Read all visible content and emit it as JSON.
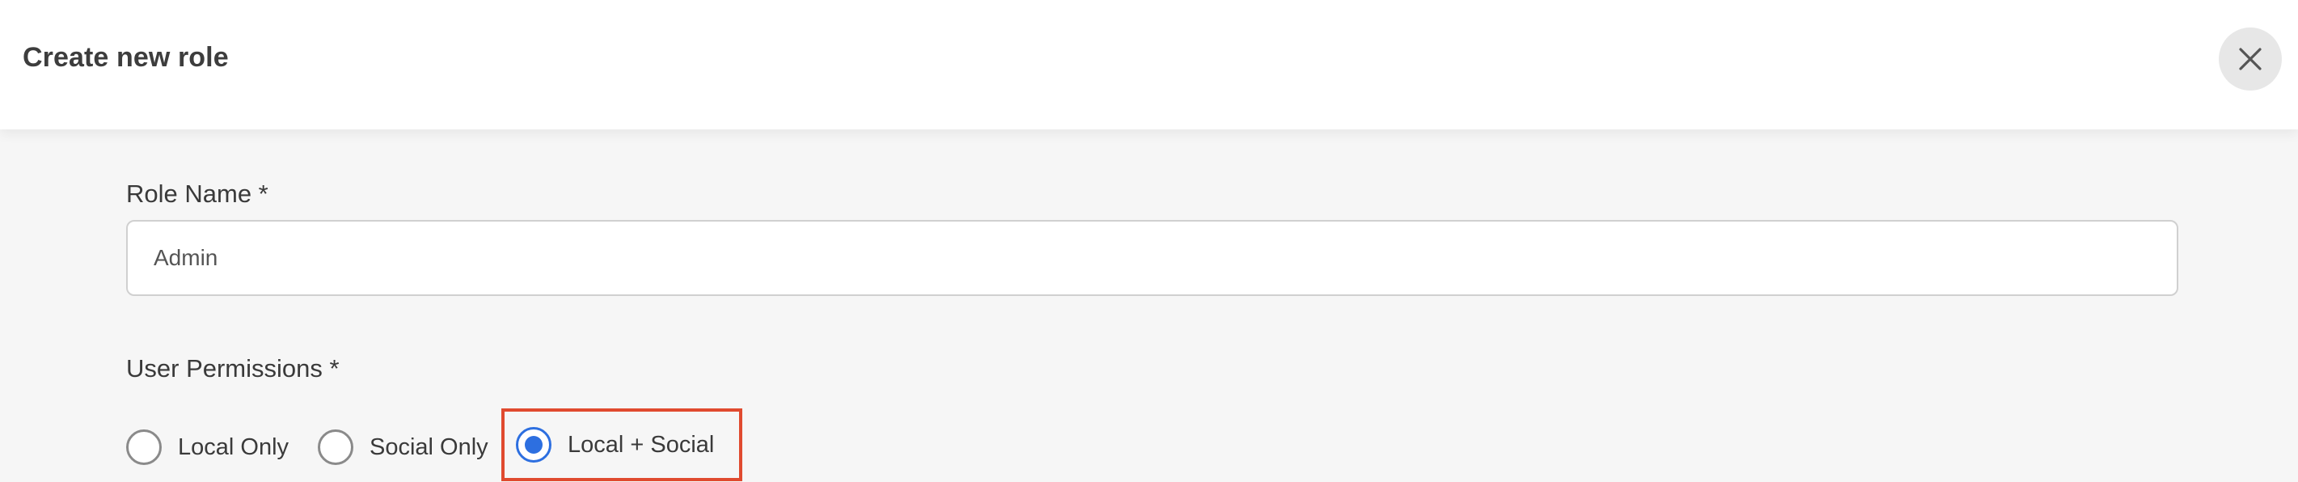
{
  "dialog": {
    "title": "Create new role",
    "close_icon": "close-icon"
  },
  "form": {
    "role_name": {
      "label": "Role Name *",
      "value": "Admin"
    },
    "user_permissions": {
      "label": "User Permissions *",
      "options": [
        {
          "label": "Local Only",
          "selected": false
        },
        {
          "label": "Social Only",
          "selected": false
        },
        {
          "label": "Local + Social",
          "selected": true,
          "highlighted": true
        }
      ]
    }
  },
  "colors": {
    "accent": "#2d6fe0",
    "highlight_border": "#e04a2f"
  }
}
